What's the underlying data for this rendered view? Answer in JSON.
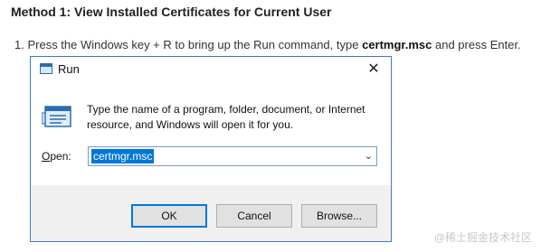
{
  "heading": "Method 1: View Installed Certificates for Current User",
  "step": {
    "number": "1.",
    "text_before": "Press the Windows key + R to bring up the Run command, type ",
    "command": "certmgr.msc",
    "text_after": " and press Enter."
  },
  "dialog": {
    "title": "Run",
    "description": "Type the name of a program, folder, document, or Internet resource, and Windows will open it for you.",
    "open_label_underlined": "O",
    "open_label_rest": "pen:",
    "open_value": "certmgr.msc",
    "ok_label": "OK",
    "cancel_label": "Cancel",
    "browse_label": "Browse...",
    "close_symbol": "✕",
    "dropdown_symbol": "⌄"
  },
  "watermark": "@稀土掘金技术社区",
  "colors": {
    "accent": "#0078d7",
    "dialog_border": "#3a7bc8",
    "footer_bg": "#f0f0f0"
  }
}
